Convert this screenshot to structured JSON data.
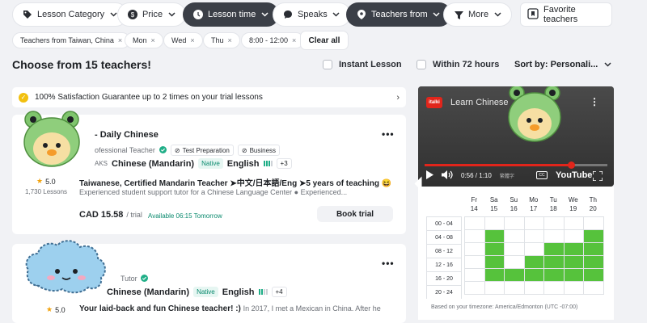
{
  "filters": [
    {
      "label": "Lesson Category",
      "icon": "tag-icon",
      "dark": false
    },
    {
      "label": "Price",
      "icon": "dollar-icon",
      "dark": false
    },
    {
      "label": "Lesson time",
      "icon": "clock-icon",
      "dark": true
    },
    {
      "label": "Speaks",
      "icon": "chat-icon",
      "dark": false
    },
    {
      "label": "Teachers from",
      "icon": "location-pin-icon",
      "dark": true
    },
    {
      "label": "More",
      "icon": "filter-icon",
      "dark": false
    }
  ],
  "favorite_label": "Favorite teachers",
  "chips": [
    "Teachers from Taiwan, China",
    "Mon",
    "Wed",
    "Thu",
    "8:00 - 12:00"
  ],
  "chip_close": "×",
  "clear_all": "Clear all",
  "heading": "Choose from 15 teachers!",
  "instant_lesson": "Instant Lesson",
  "within_72": "Within 72 hours",
  "sort_label": "Sort by: Personali...",
  "guarantee": "100% Satisfaction Guarantee up to 2 times on your trial lessons",
  "teacher1": {
    "name": "- Daily Chinese",
    "title": "ofessional Teacher",
    "tags": [
      "Test Preparation",
      "Business"
    ],
    "rating": "5.0",
    "lessons": "1,730 Lessons",
    "speaks_prefix": "AKS",
    "lang1": "Chinese (Mandarin)",
    "native": "Native",
    "lang2": "English",
    "more_langs": "+3",
    "headline": "Taiwanese, Certified Mandarin Teacher ➤中文/日本語/Eng ➤5 years of teaching 😆",
    "desc": "Experienced student support tutor for a Chinese Language Center ● Experienced...",
    "price": "CAD 15.58",
    "price_unit": "/ trial",
    "available": "Available 06:15 Tomorrow",
    "book": "Book trial",
    "more": "•••"
  },
  "teacher2": {
    "title": "Tutor",
    "rating": "5.0",
    "lang1": "Chinese (Mandarin)",
    "native": "Native",
    "lang2": "English",
    "more_langs": "+4",
    "headline": "Your laid-back and fun Chinese teacher! :)",
    "desc": "In 2017, I met a Mexican in China. After he",
    "more": "•••"
  },
  "video": {
    "title": "Learn Chinese",
    "channel_badge": "italki",
    "time": "0:56 / 1:10",
    "extra": "繁體字",
    "platform": "YouTube",
    "progress": 0.8
  },
  "schedule": {
    "days": [
      {
        "name": "Fr",
        "date": "14"
      },
      {
        "name": "Sa",
        "date": "15"
      },
      {
        "name": "Su",
        "date": "16"
      },
      {
        "name": "Mo",
        "date": "17"
      },
      {
        "name": "Tu",
        "date": "18"
      },
      {
        "name": "We",
        "date": "19"
      },
      {
        "name": "Th",
        "date": "20"
      }
    ],
    "slots": [
      "00 - 04",
      "04 - 08",
      "08 - 12",
      "12 - 16",
      "16 - 20",
      "20 - 24"
    ],
    "availability": [
      [
        0,
        0,
        0,
        0,
        0,
        0,
        0
      ],
      [
        0,
        1,
        0,
        0,
        0,
        0,
        1
      ],
      [
        0,
        1,
        0,
        0,
        1,
        1,
        1
      ],
      [
        0,
        1,
        0,
        1,
        1,
        1,
        1
      ],
      [
        0,
        1,
        1,
        1,
        1,
        1,
        1
      ],
      [
        0,
        0,
        0,
        0,
        0,
        0,
        0
      ]
    ],
    "timezone_note": "Based on your timezone: America/Edmonton (UTC -07:00)"
  },
  "colors": {
    "accent_green": "#56c23c",
    "dark_pill": "#3b3f47",
    "star": "#f2a20c"
  }
}
